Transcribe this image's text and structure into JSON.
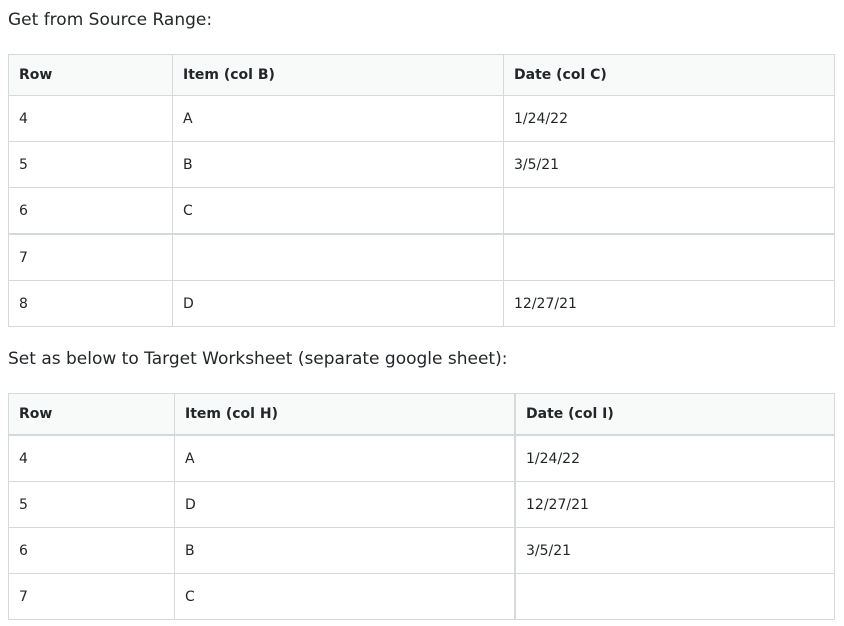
{
  "source": {
    "heading": "Get from Source Range:",
    "columns": [
      "Row",
      "Item (col B)",
      "Date (col C)"
    ],
    "rows": [
      [
        "4",
        "A",
        "1/24/22"
      ],
      [
        "5",
        "B",
        "3/5/21"
      ],
      [
        "6",
        "C",
        ""
      ],
      [
        "7",
        "",
        ""
      ],
      [
        "8",
        "D",
        "12/27/21"
      ]
    ]
  },
  "target": {
    "heading": "Set as below to Target Worksheet (separate google sheet):",
    "columns": [
      "Row",
      "Item (col H)",
      "Date (col I)"
    ],
    "rows": [
      [
        "4",
        "A",
        "1/24/22"
      ],
      [
        "5",
        "D",
        "12/27/21"
      ],
      [
        "6",
        "B",
        "3/5/21"
      ],
      [
        "7",
        "C",
        ""
      ]
    ]
  }
}
